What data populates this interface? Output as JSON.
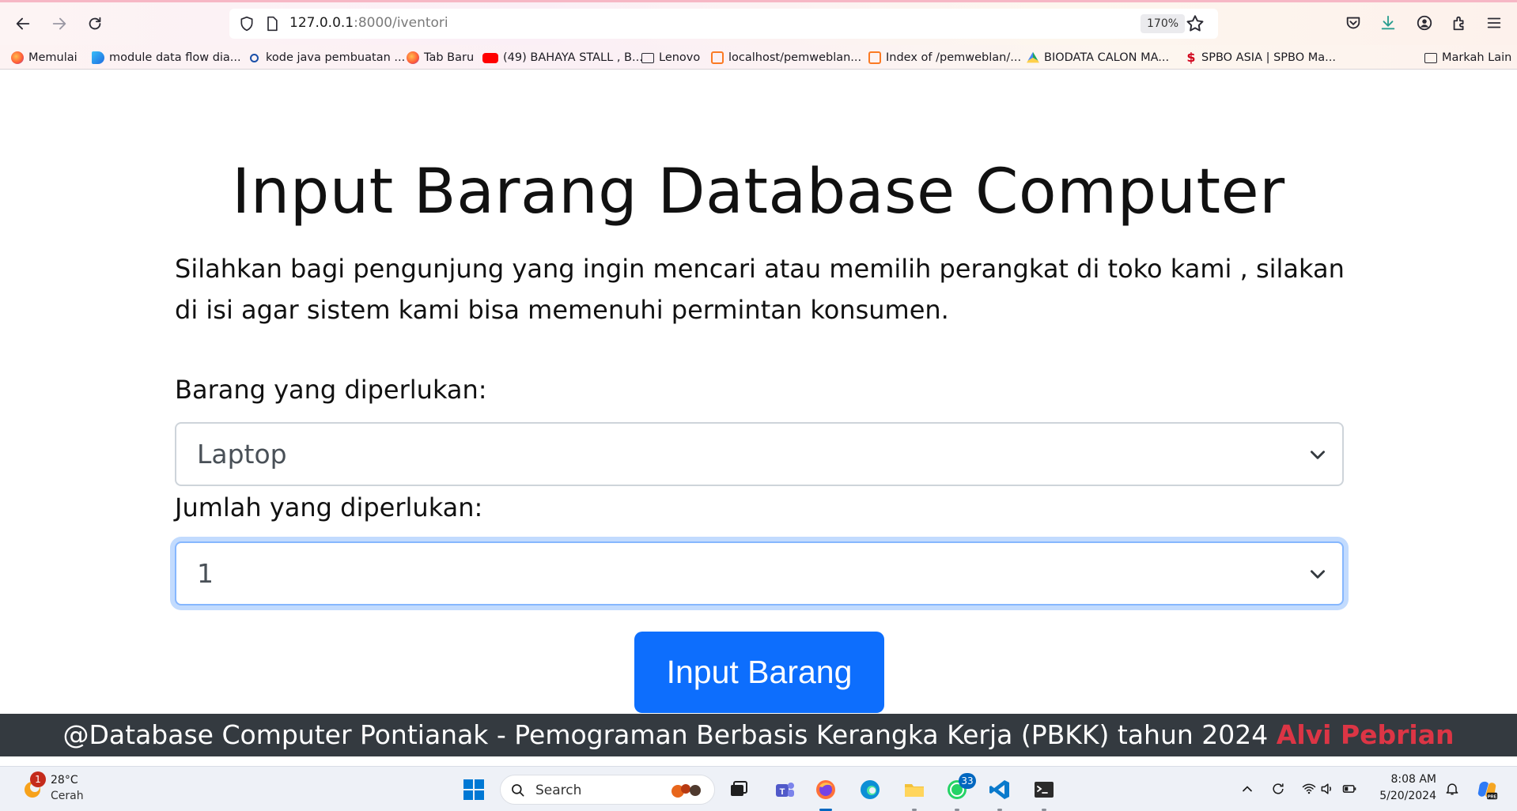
{
  "browser": {
    "url_host": "127.0.0.1",
    "url_path": ":8000/iventori",
    "zoom": "170%",
    "bookmarks": [
      {
        "label": "Memulai",
        "icon": "firefox-icon"
      },
      {
        "label": "module data flow dia...",
        "icon": "bing-icon"
      },
      {
        "label": "kode java pembuatan ...",
        "icon": "search-icon"
      },
      {
        "label": "Tab Baru",
        "icon": "firefox-icon"
      },
      {
        "label": "(49) BAHAYA STALL , B...",
        "icon": "youtube-icon"
      },
      {
        "label": "Lenovo",
        "icon": "folder-icon"
      },
      {
        "label": "localhost/pemweblan...",
        "icon": "xampp-icon"
      },
      {
        "label": "Index of /pemweblan/...",
        "icon": "xampp-icon"
      },
      {
        "label": "BIODATA CALON MA...",
        "icon": "google-drive-icon"
      },
      {
        "label": "SPBO ASIA | SPBO Ma...",
        "icon": "spbo-icon"
      }
    ],
    "other_bookmarks": "Markah Lain"
  },
  "page": {
    "title": "Input Barang Database Computer",
    "intro": "Silahkan bagi pengunjung yang ingin mencari atau memilih perangkat di toko kami , silakan di isi agar sistem kami bisa memenuhi permintan konsumen.",
    "item_label": "Barang yang diperlukan:",
    "item_value": "Laptop",
    "qty_label": "Jumlah yang diperlukan:",
    "qty_value": "1",
    "submit_label": "Input Barang"
  },
  "footer": {
    "text": "@Database Computer Pontianak - Pemograman Berbasis Kerangka Kerja (PBKK) tahun 2024",
    "author": "Alvi Pebrian"
  },
  "taskbar": {
    "weather_temp": "28°C",
    "weather_desc": "Cerah",
    "weather_badge": "1",
    "search_placeholder": "Search",
    "whatsapp_badge": "33",
    "time": "8:08 AM",
    "date": "5/20/2024"
  },
  "colors": {
    "primary": "#0d6efd",
    "footer_bg": "#343a40",
    "author": "#dc3545",
    "focus_ring": "#86b7fe"
  }
}
